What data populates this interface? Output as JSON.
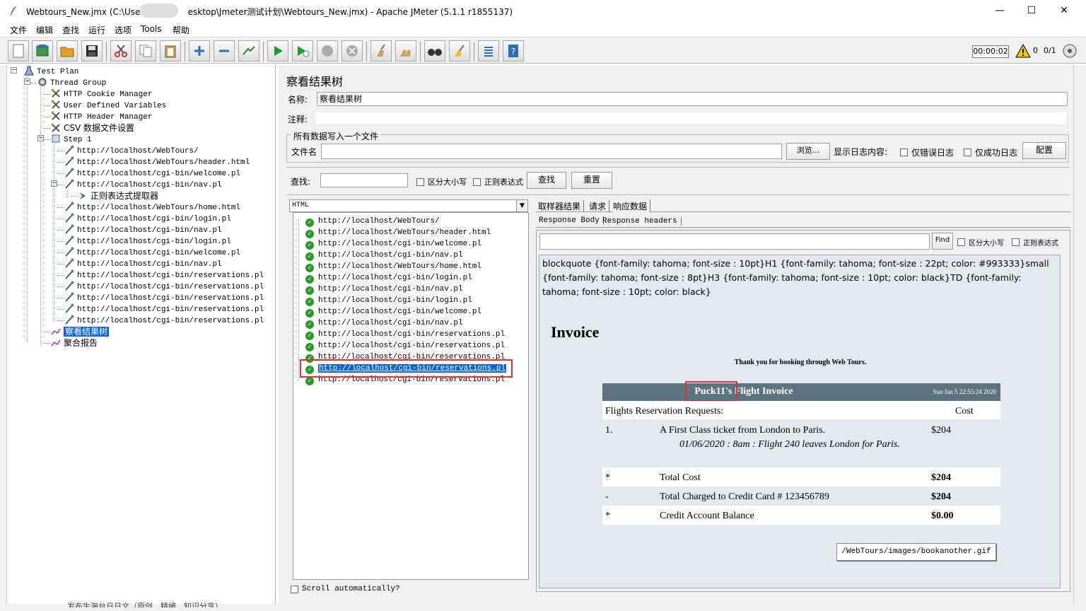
{
  "window": {
    "app_icon": "feather-icon",
    "title": "Webtours_New.jmx (C:\\Users\\",
    "title_rest": "esktop\\Jmeter测试计划\\Webtours_New.jmx) - Apache JMeter (5.1.1 r1855137)",
    "minimize": "—",
    "maximize": "☐",
    "close": "✕"
  },
  "menu": [
    "文件",
    "编辑",
    "查找",
    "运行",
    "选项",
    "Tools",
    "帮助"
  ],
  "toolbar": {
    "timer": "00:00:02",
    "warn_count": "0",
    "threads": "0/1"
  },
  "tree": {
    "items": [
      {
        "label": "Test Plan",
        "icon": "flask-icon"
      },
      {
        "label": "Thread Group",
        "icon": "gear-icon"
      },
      {
        "label": "HTTP Cookie Manager",
        "icon": "wrench-icon"
      },
      {
        "label": "User Defined Variables",
        "icon": "wrench-icon"
      },
      {
        "label": "HTTP Header Manager",
        "icon": "wrench-icon"
      },
      {
        "label": "CSV 数据文件设置",
        "icon": "wrench-icon"
      },
      {
        "label": "Step 1",
        "icon": "controller-icon"
      },
      {
        "label": "http://localhost/WebTours/",
        "icon": "pipette-icon"
      },
      {
        "label": "http://localhost/WebTours/header.html",
        "icon": "pipette-icon"
      },
      {
        "label": "http://localhost/cgi-bin/welcome.pl",
        "icon": "pipette-icon"
      },
      {
        "label": "http://localhost/cgi-bin/nav.pl",
        "icon": "pipette-icon"
      },
      {
        "label": "正则表达式提取器",
        "icon": "arrow-icon"
      },
      {
        "label": "http://localhost/WebTours/home.html",
        "icon": "pipette-icon"
      },
      {
        "label": "http://localhost/cgi-bin/login.pl",
        "icon": "pipette-icon"
      },
      {
        "label": "http://localhost/cgi-bin/nav.pl",
        "icon": "pipette-icon"
      },
      {
        "label": "http://localhost/cgi-bin/login.pl",
        "icon": "pipette-icon"
      },
      {
        "label": "http://localhost/cgi-bin/welcome.pl",
        "icon": "pipette-icon"
      },
      {
        "label": "http://localhost/cgi-bin/nav.pl",
        "icon": "pipette-icon"
      },
      {
        "label": "http://localhost/cgi-bin/reservations.pl",
        "icon": "pipette-icon"
      },
      {
        "label": "http://localhost/cgi-bin/reservations.pl",
        "icon": "pipette-icon"
      },
      {
        "label": "http://localhost/cgi-bin/reservations.pl",
        "icon": "pipette-icon"
      },
      {
        "label": "http://localhost/cgi-bin/reservations.pl",
        "icon": "pipette-icon"
      },
      {
        "label": "http://localhost/cgi-bin/reservations.pl",
        "icon": "pipette-icon"
      },
      {
        "label": "察看结果树",
        "icon": "graph-icon"
      },
      {
        "label": "聚合报告",
        "icon": "graph-icon"
      }
    ]
  },
  "panel": {
    "title": "察看结果树",
    "name_label": "名称:",
    "name_value": "察看结果树",
    "comment_label": "注释:",
    "group_title": "所有数据写入一个文件",
    "file_label": "文件名",
    "browse": "浏览...",
    "log_label": "显示日志内容:",
    "err_only": "仅错误日志",
    "ok_only": "仅成功日志",
    "config": "配置",
    "search_label": "查找:",
    "case": "区分大小写",
    "regex": "正则表达式",
    "find_btn": "查找",
    "reset_btn": "重置"
  },
  "results": {
    "renderer": "HTML",
    "items": [
      "http://localhost/WebTours/",
      "http://localhost/WebTours/header.html",
      "http://localhost/cgi-bin/welcome.pl",
      "http://localhost/cgi-bin/nav.pl",
      "http://localhost/WebTours/home.html",
      "http://localhost/cgi-bin/login.pl",
      "http://localhost/cgi-bin/nav.pl",
      "http://localhost/cgi-bin/login.pl",
      "http://localhost/cgi-bin/welcome.pl",
      "http://localhost/cgi-bin/nav.pl",
      "http://localhost/cgi-bin/reservations.pl",
      "http://localhost/cgi-bin/reservations.pl",
      "http://localhost/cgi-bin/reservations.pl",
      "http://localhost/cgi-bin/reservations.pl",
      "http://localhost/cgi-bin/reservations.pl"
    ],
    "scroll_auto": "Scroll automatically?"
  },
  "tabs": [
    "取样器结果",
    "请求",
    "响应数据"
  ],
  "subtabs": [
    "Response Body",
    "Response headers"
  ],
  "resp_search": {
    "find": "Find",
    "case": "区分大小写",
    "regex": "正则表达式"
  },
  "response": {
    "css_text": "blockquote {font-family: tahoma; font-size : 10pt}H1 {font-family: tahoma; font-size : 22pt; color: #993333}small {font-family: tahoma; font-size : 8pt}H3 {font-family: tahoma; font-size : 10pt; color: black}TD {font-family: tahoma; font-size : 10pt; color: black}",
    "heading": "Invoice",
    "thanks": "Thank you for booking through Web Tours.",
    "invoice_user": "Puck11's",
    "invoice_title": " Flight Invoice",
    "invoice_date": "Sun Jan 5 22:55:24 2020",
    "req_header": "Flights Reservation Requests:",
    "cost_header": "Cost",
    "row1_num": "1.",
    "row1_desc": "A First Class ticket from London to Paris.",
    "row1_cost": "$204",
    "row1_detail": "01/06/2020 : 8am : Flight 240 leaves London for Paris.",
    "total_mark": "*",
    "total_label": "Total Cost",
    "total_val": "$204",
    "charged_mark": "-",
    "charged_label": "Total Charged to Credit Card # 123456789",
    "charged_val": "$204",
    "balance_mark": "*",
    "balance_label": "Credit Account Balance",
    "balance_val": "$0.00",
    "book_another": "/WebTours/images/bookanother.gif"
  },
  "colors": {
    "selection": "#0a64d8",
    "invoice_header": "#5c7482",
    "highlight_box": "#e03030",
    "heading_color": "#1f2f5c"
  },
  "bottom_partial": "发布生海台日日文（原创、精编、知识分享）"
}
